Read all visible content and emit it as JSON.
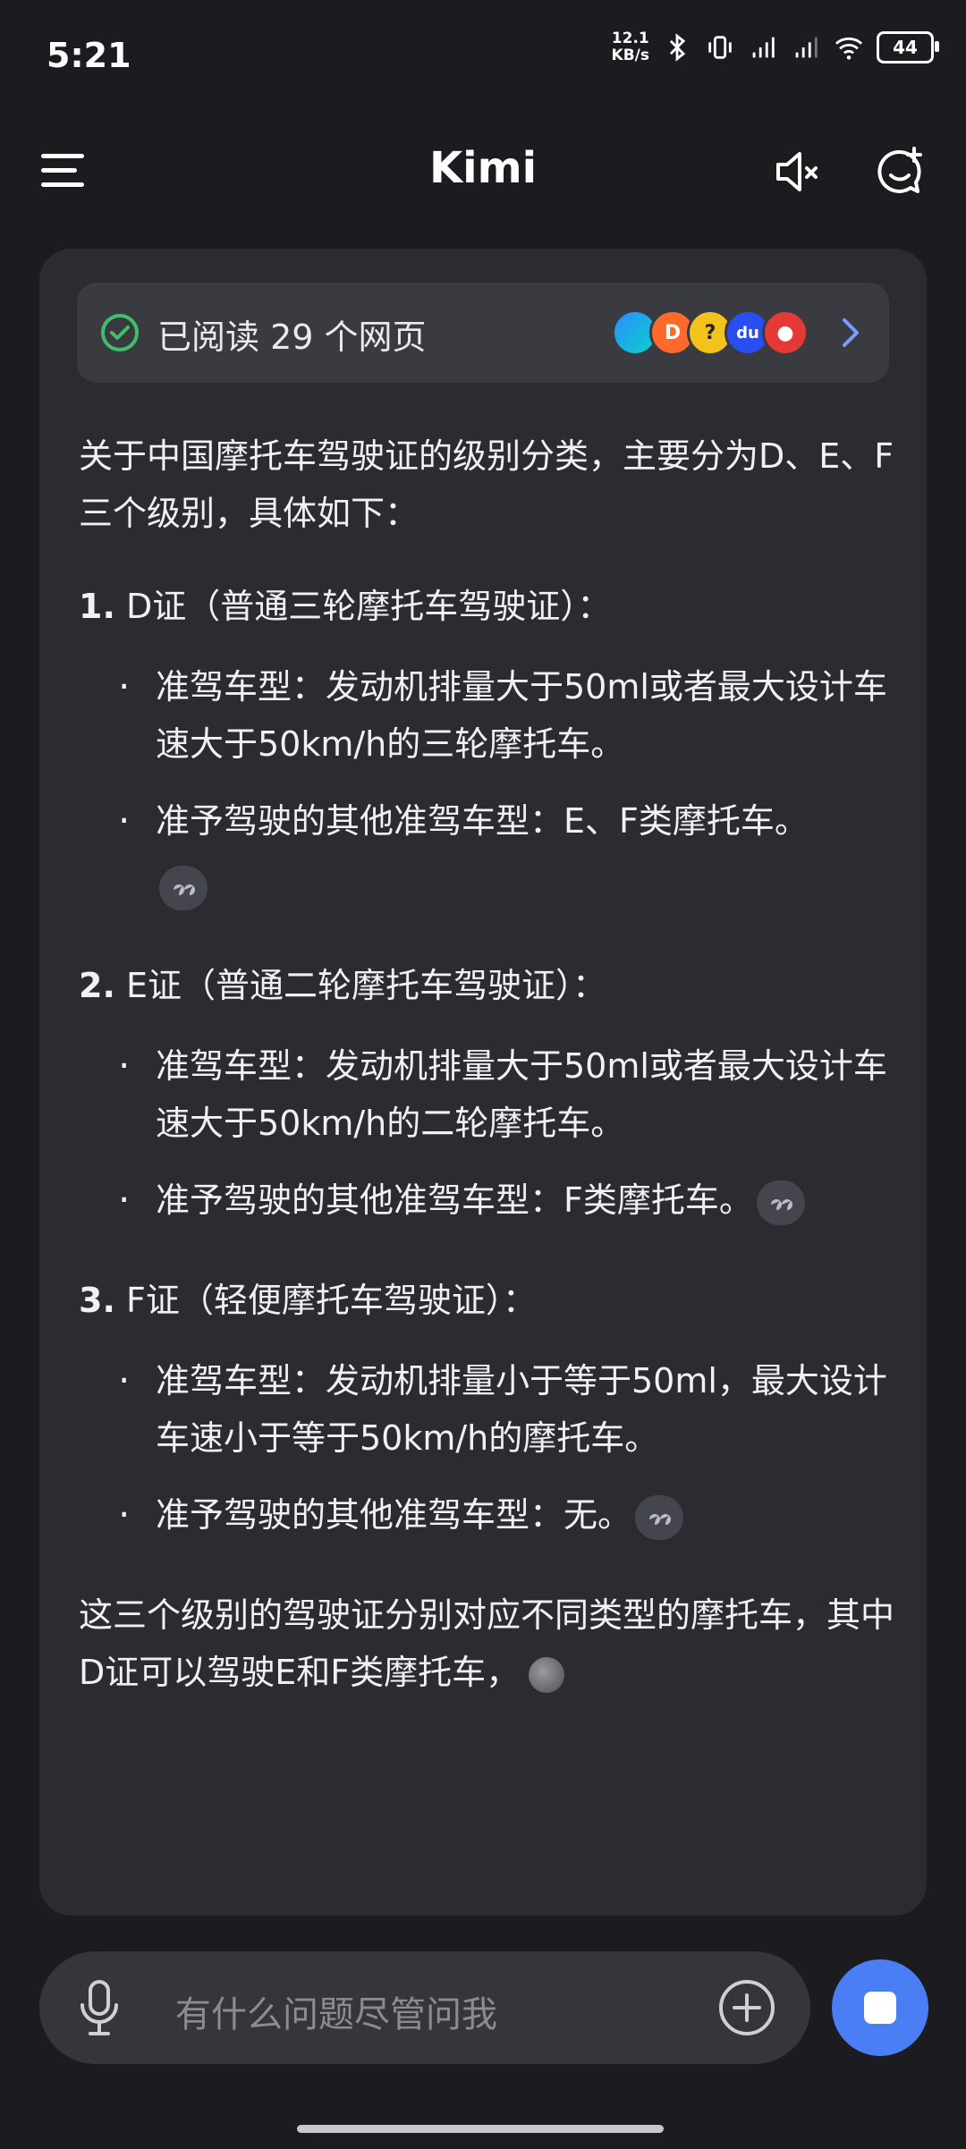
{
  "status": {
    "time": "5:21",
    "speed_value": "12.1",
    "speed_unit": "KB/s",
    "battery": "44"
  },
  "header": {
    "title": "Kimi",
    "icons": [
      "menu-icon",
      "mute-icon",
      "new-chat-icon"
    ]
  },
  "sources": {
    "text": "已阅读 29 个网页",
    "favicons": [
      "D",
      "?",
      "du",
      "●"
    ]
  },
  "answer": {
    "intro": "关于中国摩托车驾驶证的级别分类，主要分为D、E、F三个级别，具体如下：",
    "sections": [
      {
        "num": "1.",
        "title": "D证（普通三轮摩托车驾驶证）：",
        "bullets": [
          "准驾车型：发动机排量大于50ml或者最大设计车速大于50km/h的三轮摩托车。",
          "准予驾驶的其他准驾车型：E、F类摩托车。"
        ]
      },
      {
        "num": "2.",
        "title": "E证（普通二轮摩托车驾驶证）：",
        "bullets": [
          "准驾车型：发动机排量大于50ml或者最大设计车速大于50km/h的二轮摩托车。",
          "准予驾驶的其他准驾车型：F类摩托车。"
        ]
      },
      {
        "num": "3.",
        "title": "F证（轻便摩托车驾驶证）：",
        "bullets": [
          "准驾车型：发动机排量小于等于50ml，最大设计车速小于等于50km/h的摩托车。",
          "准予驾驶的其他准驾车型：无。"
        ]
      }
    ],
    "outro": "这三个级别的驾驶证分别对应不同类型的摩托车，其中D证可以驾驶E和F类摩托车，"
  },
  "input": {
    "placeholder": "有什么问题尽管问我"
  },
  "colors": {
    "accent": "#4a7ef4",
    "background": "#1b1b20",
    "card": "#2b2b31"
  }
}
